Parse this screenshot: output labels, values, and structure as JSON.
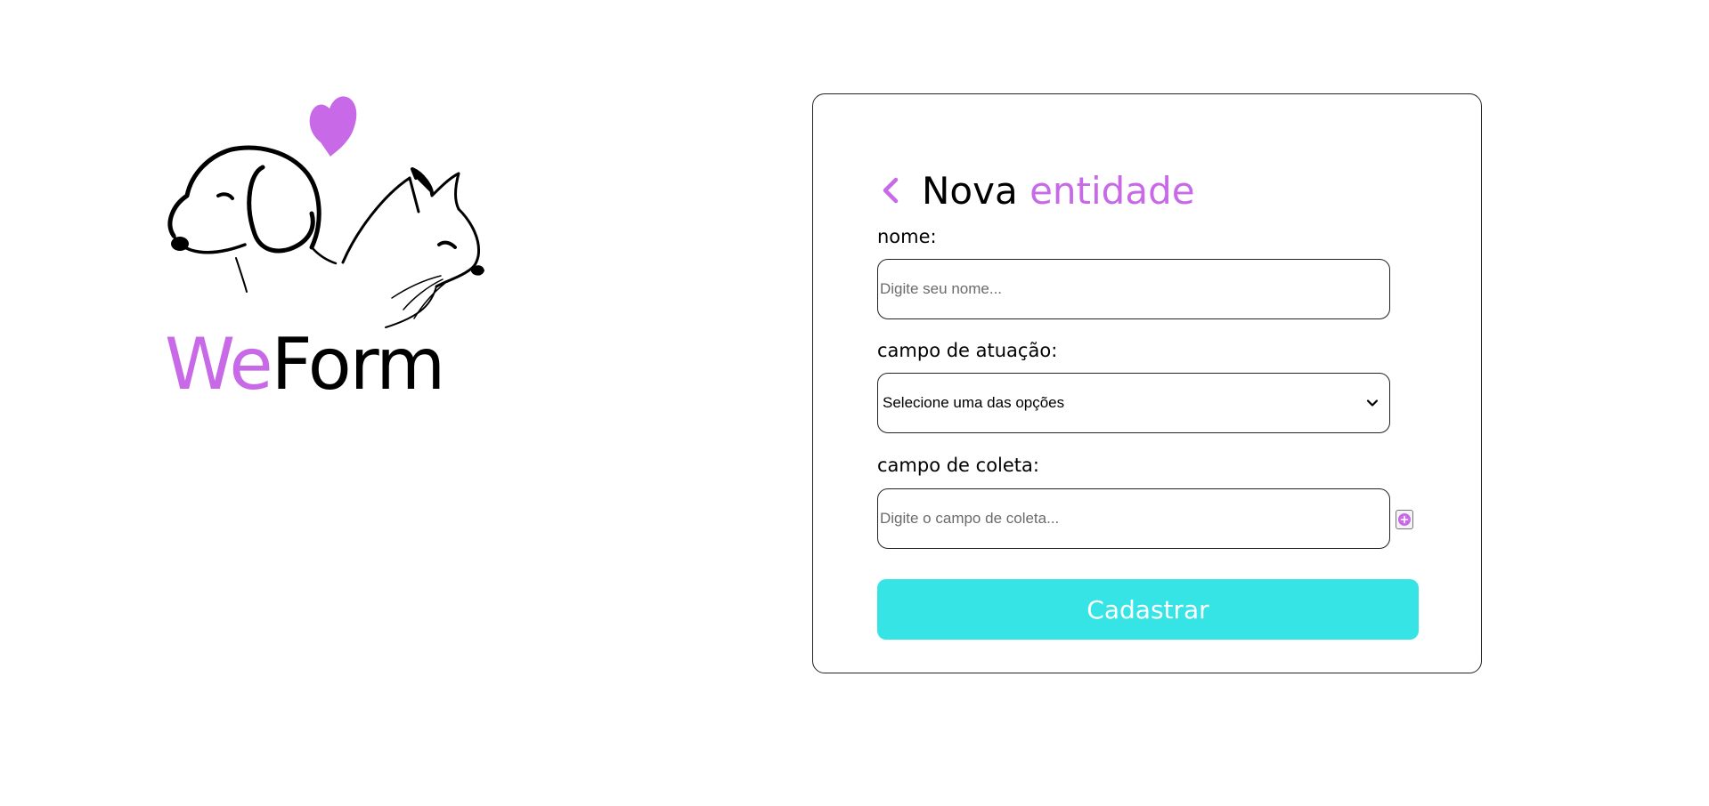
{
  "brand": {
    "name_part1": "We",
    "name_part2": "Form",
    "accent_color": "#c86ae8",
    "illustration_icons": [
      "dog-outline-icon",
      "cat-outline-icon",
      "heart-icon"
    ]
  },
  "form": {
    "back_icon": "chevron-left-icon",
    "title_part1": "Nova",
    "title_part2": "entidade",
    "fields": {
      "name": {
        "label": "nome:",
        "placeholder": "Digite seu nome...",
        "value": ""
      },
      "area": {
        "label": "campo de atuação:",
        "selected": "Selecione uma das opções"
      },
      "collection": {
        "label": "campo de coleta:",
        "placeholder": "Digite o campo de coleta...",
        "value": "",
        "add_icon": "plus-circle-icon"
      }
    },
    "submit_label": "Cadastrar",
    "submit_color": "#36e4e6"
  }
}
